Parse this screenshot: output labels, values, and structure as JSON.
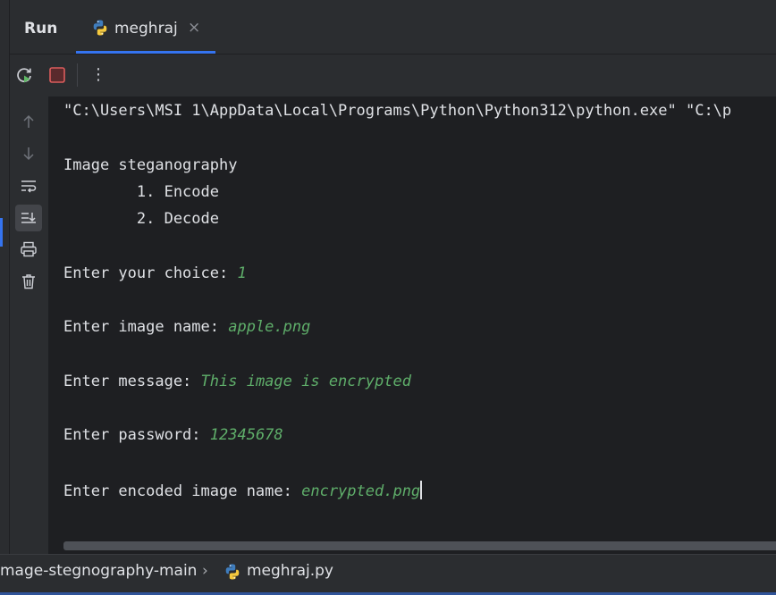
{
  "run_panel": {
    "title": "Run"
  },
  "tabs": [
    {
      "label": "meghraj",
      "icon": "python-icon",
      "close": "×"
    }
  ],
  "toolbar": {
    "buttons": [
      {
        "name": "rerun-button",
        "icon": "rerun-icon"
      },
      {
        "name": "stop-button",
        "icon": "stop-icon"
      },
      {
        "name": "more-options-button",
        "icon": "kebab-icon",
        "glyph": "⋮"
      }
    ]
  },
  "gutter": {
    "buttons": [
      {
        "name": "scroll-up-button",
        "icon": "arrow-up-icon"
      },
      {
        "name": "scroll-down-button",
        "icon": "arrow-down-icon"
      },
      {
        "name": "soft-wrap-button",
        "icon": "soft-wrap-icon"
      },
      {
        "name": "scroll-to-end-button",
        "icon": "scroll-to-end-icon",
        "active": true
      },
      {
        "name": "print-button",
        "icon": "printer-icon"
      },
      {
        "name": "clear-all-button",
        "icon": "trash-icon"
      }
    ]
  },
  "console": {
    "command": "\"C:\\Users\\MSI 1\\AppData\\Local\\Programs\\Python\\Python312\\python.exe\" \"C:\\p",
    "menu_title": "Image steganography",
    "menu_option_1": "        1. Encode",
    "menu_option_2": "        2. Decode",
    "prompts": [
      {
        "prompt": "Enter your choice: ",
        "input": "1"
      },
      {
        "prompt": "Enter image name: ",
        "input": "apple.png"
      },
      {
        "prompt": "Enter message: ",
        "input": "This image is encrypted"
      },
      {
        "prompt": "Enter password: ",
        "input": "12345678"
      },
      {
        "prompt": "Enter encoded image name: ",
        "input": "encrypted.png"
      }
    ]
  },
  "statusbar": {
    "project": "mage-stegnography-main",
    "separator": "›",
    "file": "meghraj.py",
    "file_icon": "python-icon"
  },
  "colors": {
    "background": "#1e1f22",
    "panel": "#2b2d30",
    "accent": "#3574f0",
    "user_input": "#5fae6a",
    "stop": "#db5c5c",
    "run_green": "#5fb865"
  }
}
